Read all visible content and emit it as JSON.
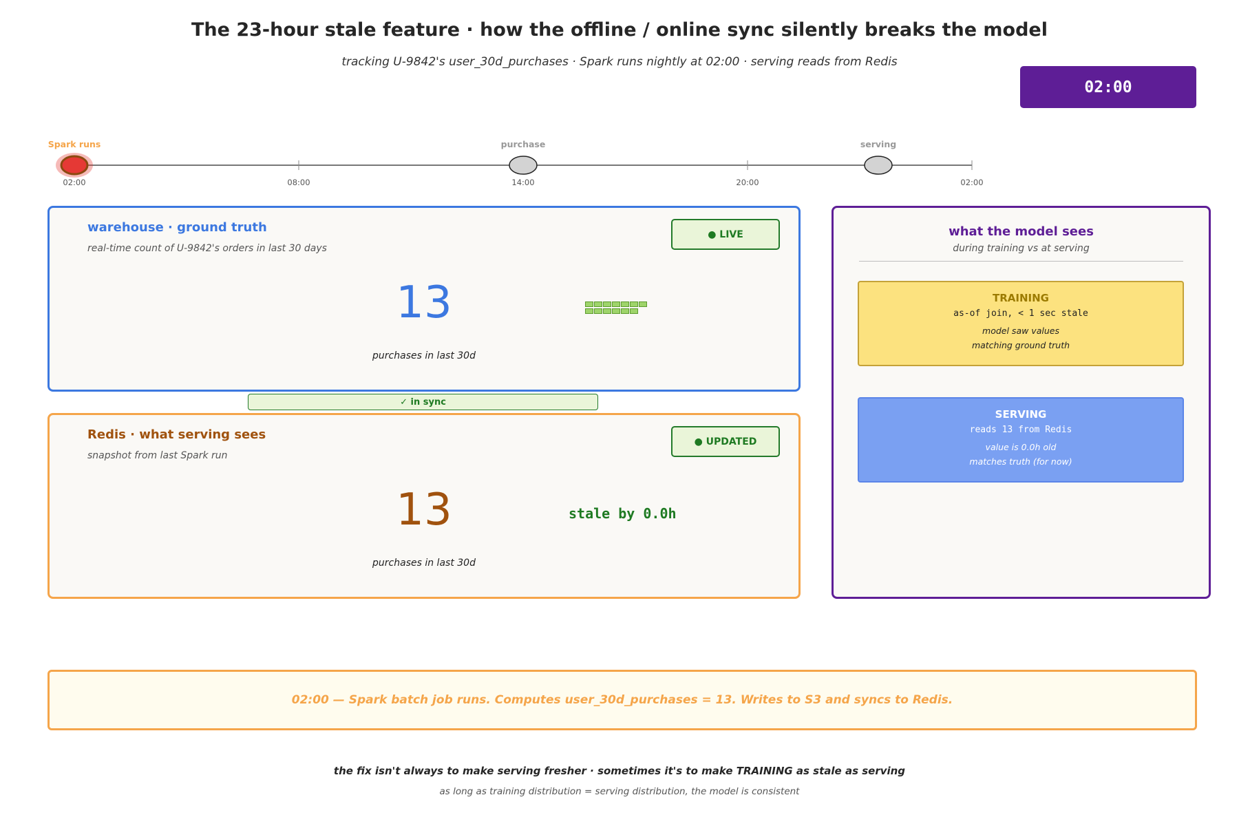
{
  "header": {
    "title": "The 23-hour stale feature · how the offline / online sync silently breaks the model",
    "subtitle": "tracking U-9842's user_30d_purchases  ·  Spark runs nightly at 02:00  ·  serving reads from Redis",
    "clock": "02:00"
  },
  "timeline": {
    "ticks": [
      "02:00",
      "08:00",
      "14:00",
      "20:00",
      "02:00"
    ],
    "markers": [
      {
        "label": "Spark runs",
        "active": true
      },
      {
        "label": "purchase",
        "active": false
      },
      {
        "label": "serving",
        "active": false
      }
    ],
    "colors": {
      "active_label": "#f5a54a",
      "inactive_label": "#999999",
      "active_fill": "#e53935",
      "inactive_fill": "#d3d3d3"
    }
  },
  "warehouse": {
    "title": "warehouse  ·  ground truth",
    "subtitle": "real-time count of U-9842's orders in last 30 days",
    "badge": "● LIVE",
    "value": "13",
    "caption": "purchases in last 30d",
    "block_count": 13,
    "color": "#3c78e0"
  },
  "sync": {
    "label": "✓ in sync"
  },
  "redis": {
    "title": "Redis  ·  what serving sees",
    "subtitle": "snapshot from last Spark run",
    "badge": "● UPDATED",
    "value": "13",
    "caption": "purchases in last 30d",
    "stale": "stale by 0.0h",
    "color": "#a0520e"
  },
  "model": {
    "title": "what the model sees",
    "subtitle": "during training vs at serving",
    "training": {
      "head": "TRAINING",
      "mono": "as-of join, < 1 sec stale",
      "note1": "model saw values",
      "note2": "matching ground truth"
    },
    "serving": {
      "head": "SERVING",
      "mono": "reads 13 from Redis",
      "note1": "value is 0.0h old",
      "note2": "matches truth (for now)"
    }
  },
  "event": {
    "text": "02:00 — Spark batch job runs. Computes user_30d_purchases = 13. Writes to S3 and syncs to Redis."
  },
  "footer": {
    "line1": "the fix isn't always to make serving fresher · sometimes it's to make TRAINING as stale as serving",
    "line2": "as long as training distribution = serving distribution, the model is consistent"
  }
}
